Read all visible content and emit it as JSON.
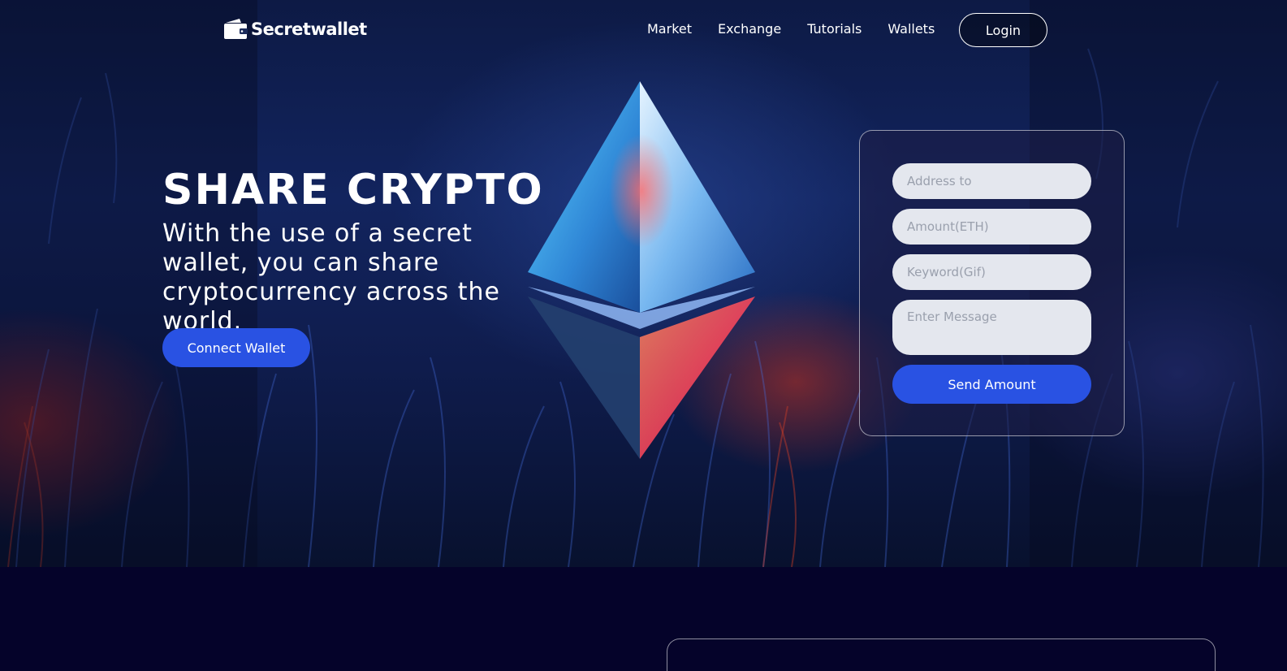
{
  "brand": {
    "name": "Secretwallet"
  },
  "nav": {
    "links": [
      "Market",
      "Exchange",
      "Tutorials",
      "Wallets"
    ],
    "login_label": "Login"
  },
  "hero": {
    "title": "SHARE CRYPTO",
    "subtitle": "With the use of a secret wallet, you can share cryptocurrency across the world.",
    "connect_label": "Connect Wallet"
  },
  "form": {
    "address_placeholder": "Address to",
    "amount_placeholder": "Amount(ETH)",
    "keyword_placeholder": "Keyword(Gif)",
    "message_placeholder": "Enter Message",
    "send_label": "Send Amount"
  },
  "colors": {
    "accent": "#2952e3",
    "page_bg": "#05032a",
    "field_bg": "#e4e7ee"
  }
}
